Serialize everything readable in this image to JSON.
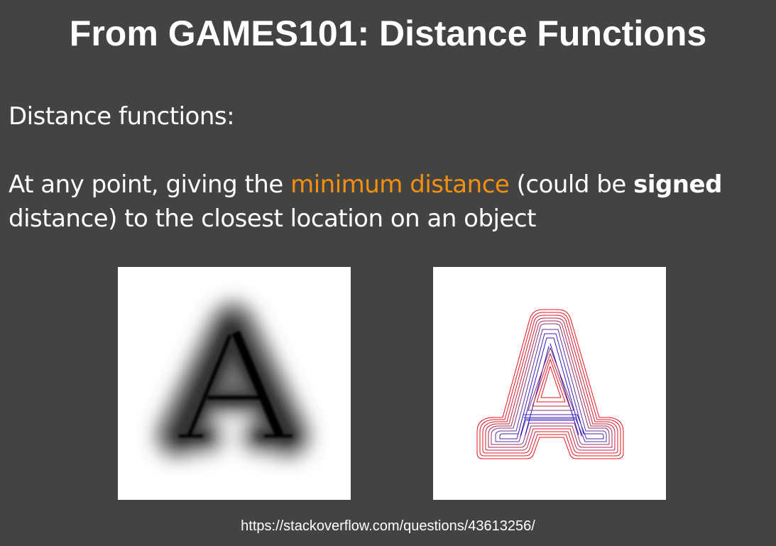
{
  "slide": {
    "title": "From GAMES101: Distance Functions",
    "heading_line": "Distance functions:",
    "body": {
      "part1": "At any point, giving the ",
      "highlight": "minimum distance",
      "part2": " (could be ",
      "bold": "signed",
      "part3": "distance) to the closest location on an object"
    },
    "colors": {
      "background": "#434343",
      "text": "#ffffff",
      "highlight": "#f5900c",
      "contour_outer": "#e8101a",
      "contour_inner": "#1a10c8"
    },
    "figures": [
      {
        "icon": "blurred-letter-a-distance-field-image"
      },
      {
        "icon": "letter-a-distance-contour-image"
      }
    ],
    "source_url": "https://stackoverflow.com/questions/43613256/"
  }
}
